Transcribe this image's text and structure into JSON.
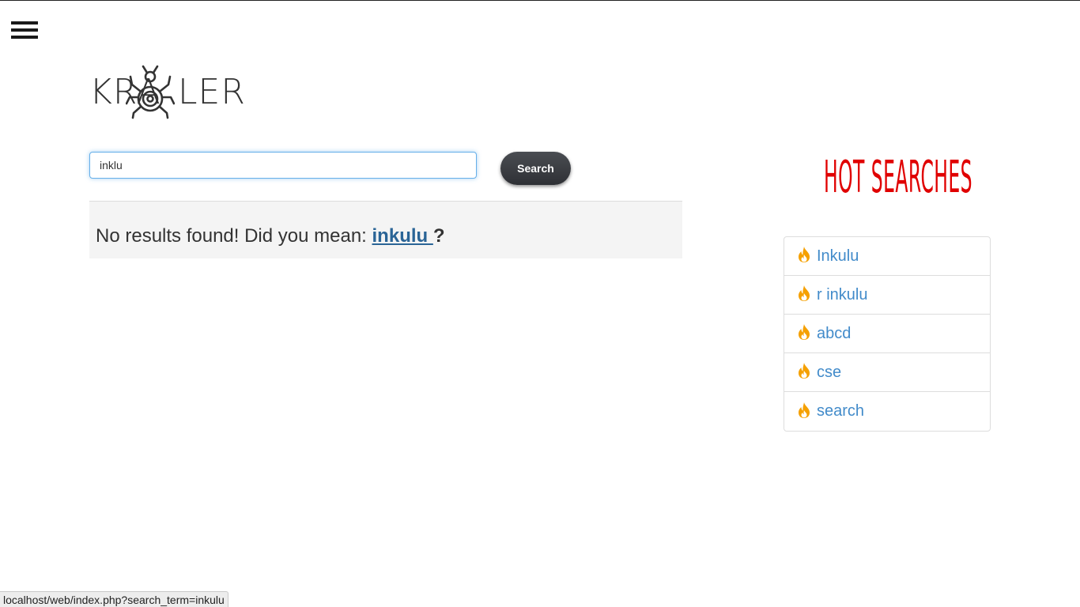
{
  "header": {
    "menu_icon": "hamburger-menu-icon"
  },
  "logo": {
    "left_text": "KRA",
    "right_text": "LER",
    "icon": "spider-icon"
  },
  "search": {
    "value": "inklu",
    "button_label": "Search"
  },
  "result": {
    "prefix": "No results found! Did you mean: ",
    "suggestion": "inkulu ",
    "suffix": "?"
  },
  "hot_searches": {
    "title": "HOT SEARCHES",
    "title_color": "#e00000",
    "item_icon": "fire-icon",
    "items": [
      {
        "label": "Inkulu"
      },
      {
        "label": "r inkulu"
      },
      {
        "label": "abcd"
      },
      {
        "label": "cse"
      },
      {
        "label": "search"
      }
    ]
  },
  "status_bar": {
    "url": "localhost/web/index.php?search_term=inkulu"
  }
}
